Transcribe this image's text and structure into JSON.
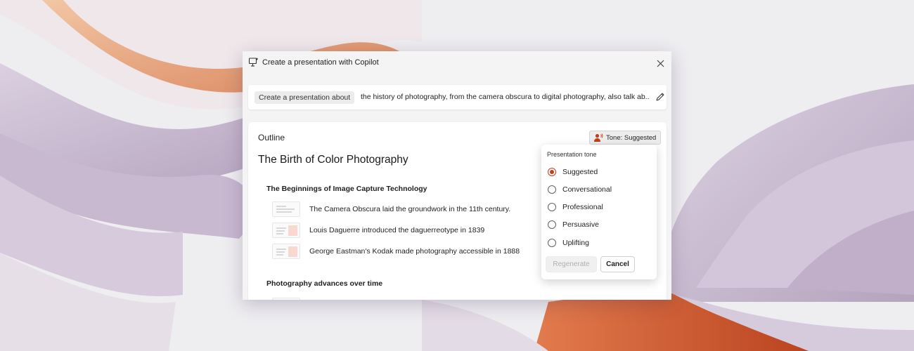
{
  "dialog": {
    "title": "Create a presentation with Copilot",
    "icons": {
      "title": "presentation-copilot-icon",
      "close": "close-icon"
    }
  },
  "prompt": {
    "chip": "Create a presentation about",
    "text": "the history of photography, from the camera obscura to digital photography, also talk ab...",
    "edit_icon": "pencil-icon"
  },
  "outline": {
    "label": "Outline",
    "slide_title": "The Birth of Color Photography",
    "sections": [
      {
        "heading": "The Beginnings of Image Capture Technology",
        "items": [
          "The Camera Obscura laid the groundwork in the 11th century.",
          "Louis Daguerre introduced the daguerreotype in 1839",
          "George Eastman's Kodak made photography accessible in 1888"
        ]
      },
      {
        "heading": "Photography advances over time"
      }
    ]
  },
  "tone": {
    "button_label": "Tone: Suggested",
    "button_icon": "tone-person-icon",
    "popup_label": "Presentation tone",
    "options": [
      "Suggested",
      "Conversational",
      "Professional",
      "Persuasive",
      "Uplifting"
    ],
    "selected": "Suggested",
    "regenerate_label": "Regenerate",
    "cancel_label": "Cancel"
  },
  "colors": {
    "accent": "#c43e1c",
    "thumb_picture": "#f9d9cf"
  }
}
